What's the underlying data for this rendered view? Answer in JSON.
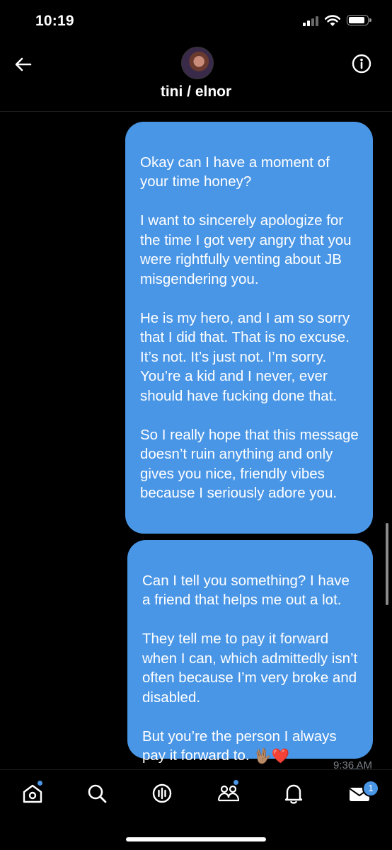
{
  "status_bar": {
    "time": "10:19"
  },
  "header": {
    "conversation_name": "tini / elnor"
  },
  "messages": [
    {
      "text": "Okay can I have a moment of your time honey?\n\nI want to sincerely apologize for the time I got very angry that you were rightfully venting about JB misgendering you.\n\nHe is my hero, and I am so sorry that I did that. That is no excuse. It’s not. It’s just not. I’m sorry. You’re a kid and I never, ever should have fucking done that.\n\nSo I really hope that this message doesn’t ruin anything and only gives you nice, friendly vibes because I seriously adore you."
    },
    {
      "text": "Can I tell you something? I have a friend that helps me out a lot.\n\nThey tell me to pay it forward when I can, which admittedly isn’t often because I’m very broke and disabled.\n\nBut you’re the person I always pay it forward to. ",
      "emoji": "🖖🏽❤️"
    }
  ],
  "timestamp": "9:36 AM",
  "tabbar": {
    "items": [
      "home-icon",
      "search-icon",
      "spaces-icon",
      "communities-icon",
      "notifications-icon",
      "messages-icon"
    ],
    "messages_badge": "1"
  },
  "colors": {
    "bubble": "#4a96e6",
    "background": "#000000"
  }
}
